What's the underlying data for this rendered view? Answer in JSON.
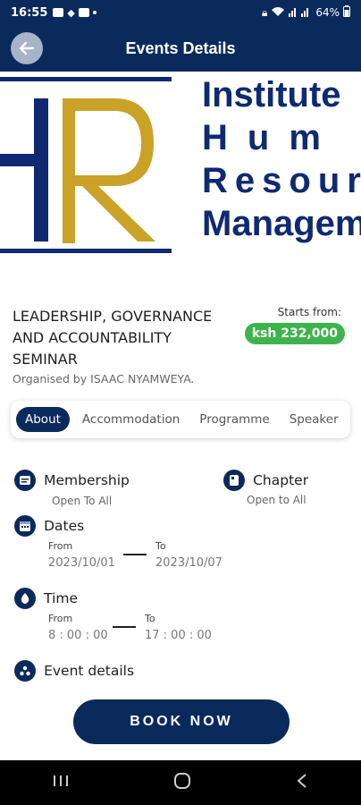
{
  "status_bar": {
    "time": "16:55",
    "battery": "64%"
  },
  "app_bar": {
    "title": "Events Details"
  },
  "banner": {
    "line1": "Institute",
    "line2": "Hum",
    "line3": "Resour",
    "line4": "Managem",
    "logo_colors": {
      "navy": "#0f2a70",
      "gold": "#c9a227"
    }
  },
  "event": {
    "title": "LEADERSHIP, GOVERNANCE AND ACCOUNTABILITY SEMINAR",
    "organiser": "Organised by ISAAC NYAMWEYA."
  },
  "price": {
    "label": "Starts from:",
    "value": "ksh 232,000"
  },
  "tabs": [
    {
      "label": "About",
      "active": true
    },
    {
      "label": "Accommodation",
      "active": false
    },
    {
      "label": "Programme",
      "active": false
    },
    {
      "label": "Speaker",
      "active": false
    }
  ],
  "details": {
    "membership": {
      "label": "Membership",
      "value": "Open To All"
    },
    "chapter": {
      "label": "Chapter",
      "value": "Open to All"
    },
    "dates": {
      "label": "Dates",
      "from_label": "From",
      "from": "2023/10/01",
      "to_label": "To",
      "to": "2023/10/07"
    },
    "time": {
      "label": "Time",
      "from_label": "From",
      "from": "8 : 00 : 00",
      "to_label": "To",
      "to": "17 : 00 : 00"
    },
    "event_details": {
      "label": "Event details"
    }
  },
  "book_button": {
    "label": "BOOK NOW"
  },
  "colors": {
    "primary": "#0b2a5c",
    "price_green": "#3cb44b"
  }
}
